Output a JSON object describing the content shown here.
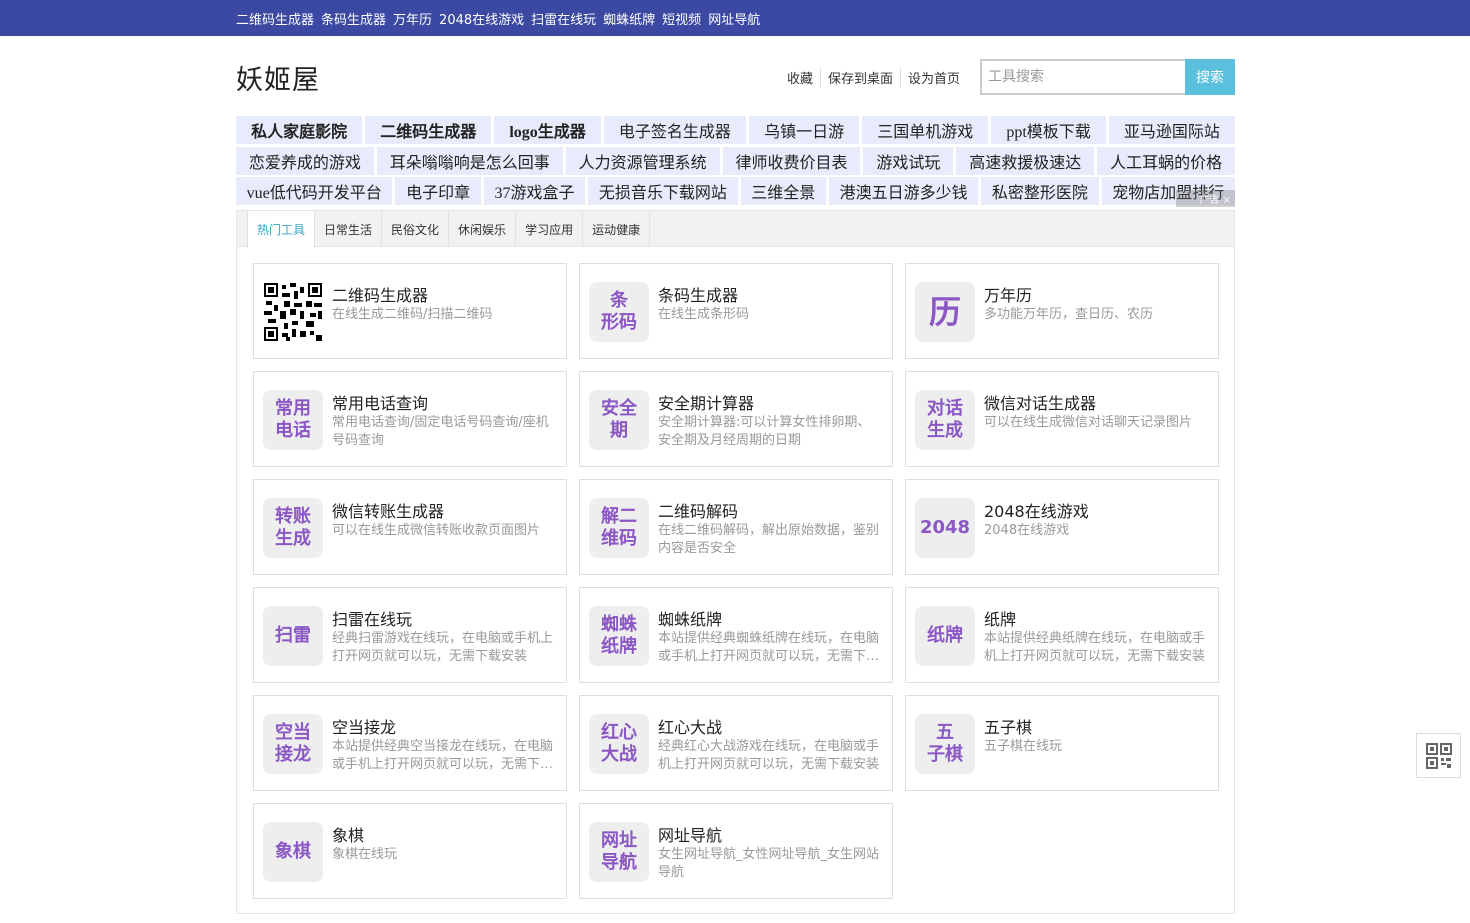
{
  "topnav": [
    "二维码生成器",
    "条码生成器",
    "万年历",
    "2048在线游戏",
    "扫雷在线玩",
    "蜘蛛纸牌",
    "短视频",
    "网址导航"
  ],
  "site_title": "妖姬屋",
  "actions": [
    "收藏",
    "保存到桌面",
    "设为首页"
  ],
  "search": {
    "placeholder": "工具搜索",
    "button": "搜索"
  },
  "ad_rows": [
    [
      "私人家庭影院",
      "二维码生成器",
      "logo生成器",
      "电子签名生成器",
      "乌镇一日游",
      "三国单机游戏",
      "ppt模板下载",
      "亚马逊国际站"
    ],
    [
      "恋爱养成的游戏",
      "耳朵嗡嗡响是怎么回事",
      "人力资源管理系统",
      "律师收费价目表",
      "游戏试玩",
      "高速救援极速达",
      "人工耳蜗的价格"
    ],
    [
      "vue低代码开发平台",
      "电子印章",
      "37游戏盒子",
      "无损音乐下载网站",
      "三维全景",
      "港澳五日游多少钱",
      "私密整形医院",
      "宠物店加盟排行"
    ]
  ],
  "ad_badge": "广告 ×",
  "tabs": [
    "热门工具",
    "日常生活",
    "民俗文化",
    "休闲娱乐",
    "学习应用",
    "运动健康"
  ],
  "tools": [
    {
      "icon": "qr-code-icon",
      "title": "二维码生成器",
      "desc": "在线生成二维码/扫描二维码"
    },
    {
      "icon_text": "条\n形码",
      "title": "条码生成器",
      "desc": "在线生成条形码"
    },
    {
      "icon_text": "历",
      "title": "万年历",
      "desc": "多功能万年历，查日历、农历"
    },
    {
      "icon_text": "常用\n电话",
      "title": "常用电话查询",
      "desc": "常用电话查询/固定电话号码查询/座机号码查询"
    },
    {
      "icon_text": "安全\n期",
      "title": "安全期计算器",
      "desc": "安全期计算器:可以计算女性排卵期、安全期及月经周期的日期"
    },
    {
      "icon_text": "对话\n生成",
      "title": "微信对话生成器",
      "desc": "可以在线生成微信对话聊天记录图片"
    },
    {
      "icon_text": "转账\n生成",
      "title": "微信转账生成器",
      "desc": "可以在线生成微信转账收款页面图片"
    },
    {
      "icon_text": "解二\n维码",
      "title": "二维码解码",
      "desc": "在线二维码解码，解出原始数据，鉴别内容是否安全"
    },
    {
      "icon_text": "2048",
      "title": "2048在线游戏",
      "desc": "2048在线游戏"
    },
    {
      "icon_text": "扫雷",
      "title": "扫雷在线玩",
      "desc": "经典扫雷游戏在线玩，在电脑或手机上打开网页就可以玩，无需下载安装"
    },
    {
      "icon_text": "蜘蛛\n纸牌",
      "title": "蜘蛛纸牌",
      "desc": "本站提供经典蜘蛛纸牌在线玩，在电脑或手机上打开网页就可以玩，无需下载安装"
    },
    {
      "icon_text": "纸牌",
      "title": "纸牌",
      "desc": "本站提供经典纸牌在线玩，在电脑或手机上打开网页就可以玩，无需下载安装"
    },
    {
      "icon_text": "空当\n接龙",
      "title": "空当接龙",
      "desc": "本站提供经典空当接龙在线玩，在电脑或手机上打开网页就可以玩，无需下载安装"
    },
    {
      "icon_text": "红心\n大战",
      "title": "红心大战",
      "desc": "经典红心大战游戏在线玩，在电脑或手机上打开网页就可以玩，无需下载安装"
    },
    {
      "icon_text": "五\n子棋",
      "title": "五子棋",
      "desc": "五子棋在线玩"
    },
    {
      "icon_text": "象棋",
      "title": "象棋",
      "desc": "象棋在线玩"
    },
    {
      "icon_text": "网址\n导航",
      "title": "网址导航",
      "desc": "女生网址导航_女性网址导航_女生网站导航"
    }
  ],
  "colors": {
    "topbar": "#3b49a3",
    "accent": "#5bc0de",
    "icon_text": "#8a57c4",
    "ad_bg": "#e8ebfb"
  }
}
